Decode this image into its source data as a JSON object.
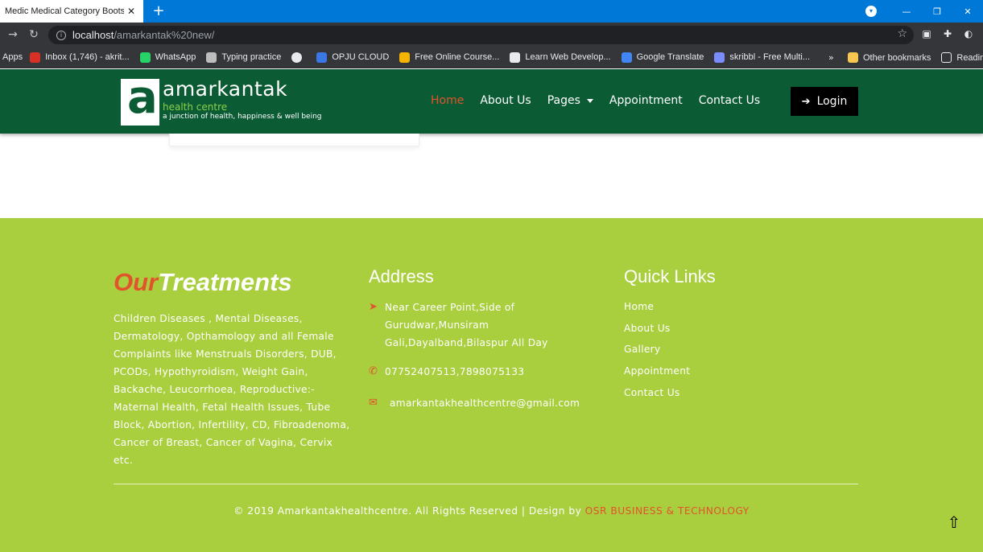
{
  "browser": {
    "tab_title": "Medic Medical Category Bootstrap",
    "tab_close": "✕",
    "new_tab": "+",
    "url_host": "localhost",
    "url_path": "/amarkantak%20new/",
    "bookmarks": [
      {
        "label": "Apps",
        "icon": "apps-grid-icon",
        "color": "#7a7a7a"
      },
      {
        "label": "Inbox (1,746) - akrit...",
        "icon": "gmail-icon",
        "color": "#d93025"
      },
      {
        "label": "WhatsApp",
        "icon": "whatsapp-icon",
        "color": "#25d366"
      },
      {
        "label": "Typing practice",
        "icon": "page-icon",
        "color": "#bdbdbd"
      },
      {
        "label": "",
        "icon": "globe-icon",
        "color": "#e8eaed"
      },
      {
        "label": "OPJU CLOUD",
        "icon": "cloud-icon",
        "color": "#3b78e7"
      },
      {
        "label": "Free Online Course...",
        "icon": "course-icon",
        "color": "#f4b400"
      },
      {
        "label": "Learn Web Develop...",
        "icon": "shield-icon",
        "color": "#e8eaed"
      },
      {
        "label": "Google Translate",
        "icon": "translate-icon",
        "color": "#4285f4"
      },
      {
        "label": "skribbl - Free Multi...",
        "icon": "pen-icon",
        "color": "#7b8cff"
      }
    ],
    "bookmarks_more": "»",
    "other_bookmarks": "Other bookmarks",
    "reading_list": "Reading list"
  },
  "header": {
    "logo_letter": "a",
    "logo_name": "amarkantak",
    "logo_sub1": "health centre",
    "logo_sub2": "a junction of health, happiness & well being",
    "nav": [
      {
        "label": "Home",
        "active": true
      },
      {
        "label": "About Us",
        "active": false
      },
      {
        "label": "Pages",
        "active": false,
        "dropdown": true
      },
      {
        "label": "Appointment",
        "active": false
      },
      {
        "label": "Contact Us",
        "active": false
      }
    ],
    "login_label": "Login"
  },
  "footer": {
    "treatments_title_a": "Our",
    "treatments_title_b": "Treatments",
    "treatments_text": "Children Diseases , Mental Diseases, Dermatology, Opthamology and all Female Complaints like Menstruals Disorders, DUB, PCODs, Hypothyroidism, Weight Gain, Backache, Leucorrhoea, Reproductive:- Maternal Health, Fetal Health Issues, Tube Block, Abortion, Infertility, CD, Fibroadenoma, Cancer of Breast, Cancer of Vagina, Cervix etc.",
    "address_title": "Address",
    "address": "Near Career Point,Side of Gurudwar,Munsiram Gali,Dayalband,Bilaspur All Day",
    "phone": "07752407513,7898075133",
    "email": "amarkantakhealthcentre@gmail.com",
    "quick_links_title": "Quick Links",
    "quick_links": [
      "Home",
      "About Us",
      "Gallery",
      "Appointment",
      "Contact Us"
    ],
    "copyright": "© 2019 Amarkantakhealthcentre. All Rights Reserved | Design by ",
    "designer": "OSR BUSINESS & TECHNOLOGY"
  },
  "colors": {
    "header_bg": "#0b5b35",
    "footer_bg": "#a9cf3f",
    "accent": "#e2532b",
    "login_bg": "#000000"
  }
}
